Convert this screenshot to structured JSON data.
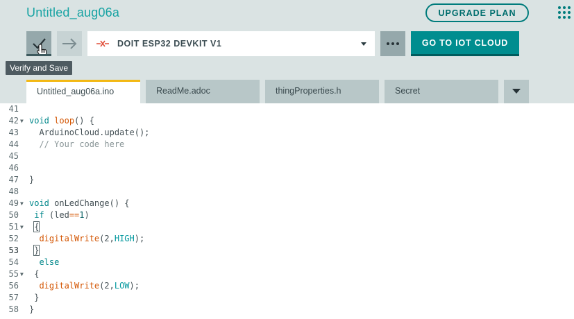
{
  "header": {
    "sketch_title": "Untitled_aug06a",
    "upgrade_label": "UPGRADE PLAN",
    "apps_icon": "grid-dots-icon"
  },
  "toolbar": {
    "verify_icon": "checkmark-icon",
    "upload_icon": "arrow-right-icon",
    "verify_tooltip": "Verify and Save",
    "board_status_icon": "disconnected-icon",
    "board_name": "DOIT ESP32 DEVKIT V1",
    "more_icon": "ellipsis-icon",
    "iot_label": "GO TO IOT CLOUD"
  },
  "tabs": [
    {
      "label": "Untitled_aug06a.ino",
      "active": true
    },
    {
      "label": "ReadMe.adoc",
      "active": false
    },
    {
      "label": "thingProperties.h",
      "active": false
    },
    {
      "label": "Secret",
      "active": false
    }
  ],
  "editor": {
    "lines": [
      {
        "n": "41",
        "fold": false,
        "tokens": []
      },
      {
        "n": "42",
        "fold": true,
        "tokens": [
          [
            "kw",
            "void"
          ],
          [
            "p",
            " "
          ],
          [
            "fn",
            "loop"
          ],
          [
            "p",
            "() {"
          ]
        ]
      },
      {
        "n": "43",
        "fold": false,
        "tokens": [
          [
            "p",
            "  ArduinoCloud.update();"
          ]
        ]
      },
      {
        "n": "44",
        "fold": false,
        "tokens": [
          [
            "cm",
            "  // Your code here"
          ]
        ]
      },
      {
        "n": "45",
        "fold": false,
        "tokens": []
      },
      {
        "n": "46",
        "fold": false,
        "tokens": []
      },
      {
        "n": "47",
        "fold": false,
        "tokens": [
          [
            "p",
            "}"
          ]
        ]
      },
      {
        "n": "48",
        "fold": false,
        "tokens": []
      },
      {
        "n": "49",
        "fold": true,
        "tokens": [
          [
            "kw",
            "void"
          ],
          [
            "p",
            " onLedChange() {"
          ]
        ]
      },
      {
        "n": "50",
        "fold": false,
        "tokens": [
          [
            "p",
            " "
          ],
          [
            "kw",
            "if"
          ],
          [
            "p",
            " (led"
          ],
          [
            "op",
            "=="
          ],
          [
            "num",
            "1"
          ],
          [
            "p",
            ")"
          ]
        ]
      },
      {
        "n": "51",
        "fold": true,
        "tokens": [
          [
            "p",
            " "
          ],
          [
            "bm",
            "{"
          ]
        ]
      },
      {
        "n": "52",
        "fold": false,
        "tokens": [
          [
            "p",
            "  "
          ],
          [
            "fn",
            "digitalWrite"
          ],
          [
            "p",
            "(2,"
          ],
          [
            "const",
            "HIGH"
          ],
          [
            "p",
            ");"
          ]
        ]
      },
      {
        "n": "53",
        "fold": false,
        "current": true,
        "tokens": [
          [
            "p",
            " "
          ],
          [
            "bm",
            "}"
          ]
        ]
      },
      {
        "n": "54",
        "fold": false,
        "tokens": [
          [
            "p",
            "  "
          ],
          [
            "kw",
            "else"
          ]
        ]
      },
      {
        "n": "55",
        "fold": true,
        "tokens": [
          [
            "p",
            " {"
          ]
        ]
      },
      {
        "n": "56",
        "fold": false,
        "tokens": [
          [
            "p",
            "  "
          ],
          [
            "fn",
            "digitalWrite"
          ],
          [
            "p",
            "(2,"
          ],
          [
            "const",
            "LOW"
          ],
          [
            "p",
            ");"
          ]
        ]
      },
      {
        "n": "57",
        "fold": false,
        "tokens": [
          [
            "p",
            " }"
          ]
        ]
      },
      {
        "n": "58",
        "fold": false,
        "tokens": [
          [
            "p",
            "}"
          ]
        ]
      }
    ]
  }
}
